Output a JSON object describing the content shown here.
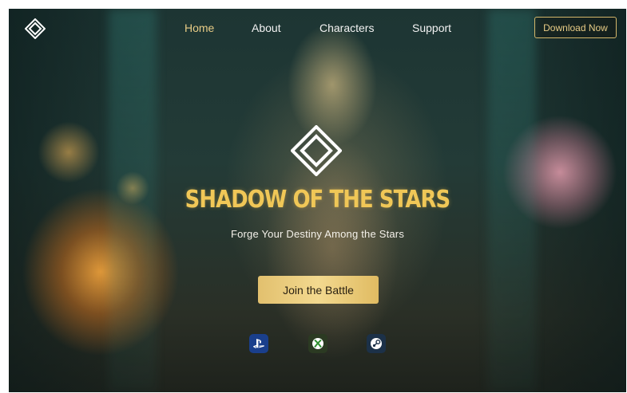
{
  "nav": {
    "links": [
      {
        "label": "Home",
        "active": true
      },
      {
        "label": "About",
        "active": false
      },
      {
        "label": "Characters",
        "active": false
      },
      {
        "label": "Support",
        "active": false
      }
    ],
    "download_label": "Download Now"
  },
  "hero": {
    "title": "SHADOW OF THE STARS",
    "subtitle": "Forge Your Destiny Among the Stars",
    "cta_label": "Join the Battle"
  },
  "platforms": [
    {
      "icon": "playstation-icon",
      "color": "#1a3f8c"
    },
    {
      "icon": "xbox-icon",
      "color": "#2b3a22"
    },
    {
      "icon": "steam-icon",
      "color": "#1c3148"
    }
  ],
  "colors": {
    "accent_gold": "#f0c757",
    "nav_active": "#e8cc86",
    "text_light": "#f2f2f2"
  }
}
